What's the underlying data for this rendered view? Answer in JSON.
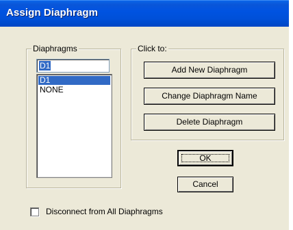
{
  "window": {
    "title": "Assign Diaphragm"
  },
  "diaphragms_group": {
    "legend": "Diaphragms",
    "name_input": {
      "value": "D1"
    },
    "list": {
      "items": [
        {
          "label": "D1",
          "selected": true
        },
        {
          "label": "NONE",
          "selected": false
        }
      ]
    }
  },
  "click_to_group": {
    "legend": "Click to:",
    "add_label": "Add New Diaphragm",
    "change_label": "Change Diaphragm Name",
    "delete_label": "Delete Diaphragm"
  },
  "buttons": {
    "ok_label": "OK",
    "cancel_label": "Cancel"
  },
  "options": {
    "disconnect_label": "Disconnect from All Diaphragms",
    "disconnect_checked": false
  },
  "colors": {
    "titlebar": "#0053e1",
    "dialog_bg": "#ece9d8",
    "selection": "#316ac5"
  }
}
